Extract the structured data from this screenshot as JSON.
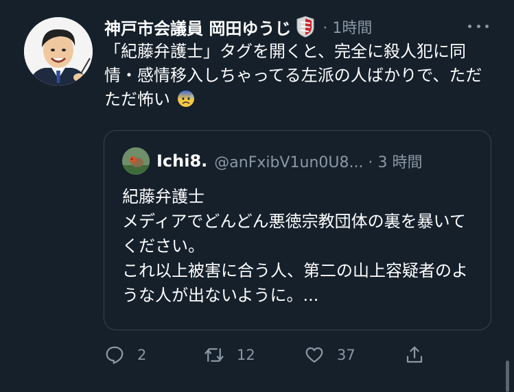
{
  "tweet": {
    "author_name": "神戸市会議員 岡田ゆうじ",
    "time": "· 1時間",
    "text": "「紀藤弁護士」タグを開くと、完全に殺人犯に同情・感情移入しちゃってる左派の人ばかりで、ただただ怖い",
    "emoji": "anxious-face-with-sweat"
  },
  "quoted": {
    "author_name": "Ichi8.",
    "handle_time": "@anFxibV1un0U8... · 3 時間",
    "text": "紀藤弁護士\nメディアでどんどん悪徳宗教団体の裏を暴いてください。\nこれ以上被害に合う人、第二の山上容疑者のような人が出ないように。..."
  },
  "actions": {
    "reply_count": "2",
    "retweet_count": "12",
    "like_count": "37"
  },
  "colors": {
    "background": "#15202b",
    "secondary_text": "#8b98a5",
    "border": "#38444d"
  }
}
